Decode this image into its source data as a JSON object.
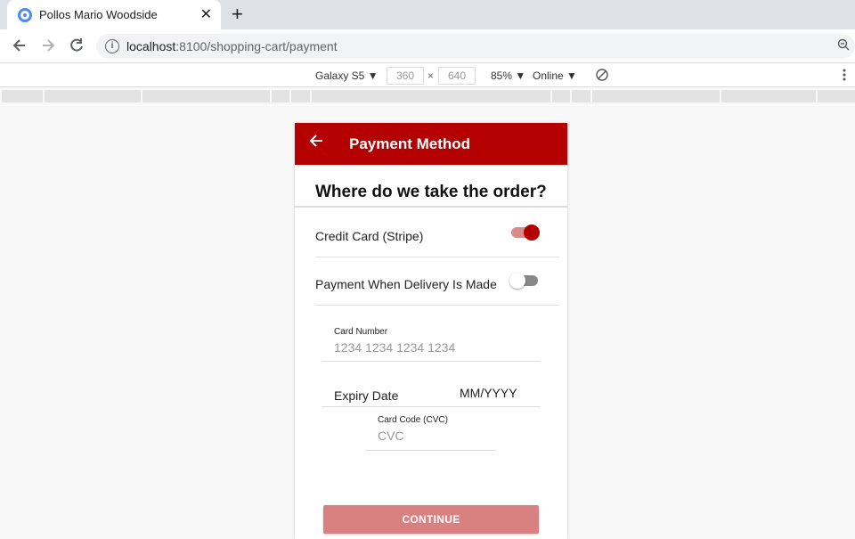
{
  "browser": {
    "tab_title": "Pollos Mario Woodside",
    "tab_close": "✕",
    "new_tab": "+",
    "url_host": "localhost",
    "url_path": ":8100/shopping-cart/payment"
  },
  "devtools": {
    "device": "Galaxy S5 ▼",
    "width": "360",
    "times": "×",
    "height": "640",
    "zoom": "85% ▼",
    "network": "Online ▼"
  },
  "app": {
    "header_title": "Payment Method",
    "subheader": "Where do we take the order?",
    "options": [
      {
        "label": "Credit Card (Stripe)",
        "checked": true
      },
      {
        "label": "Payment When Delivery Is Made",
        "checked": false
      }
    ],
    "card_number": {
      "label": "Card Number",
      "placeholder": "1234 1234 1234 1234"
    },
    "expiry": {
      "label": "Expiry Date",
      "placeholder": "MM/YYYY"
    },
    "cvc": {
      "label": "Card Code (CVC)",
      "placeholder": "CVC"
    },
    "continue_label": "CONTINUE"
  },
  "colors": {
    "primary": "#b40000",
    "button_disabled": "#d98080"
  }
}
